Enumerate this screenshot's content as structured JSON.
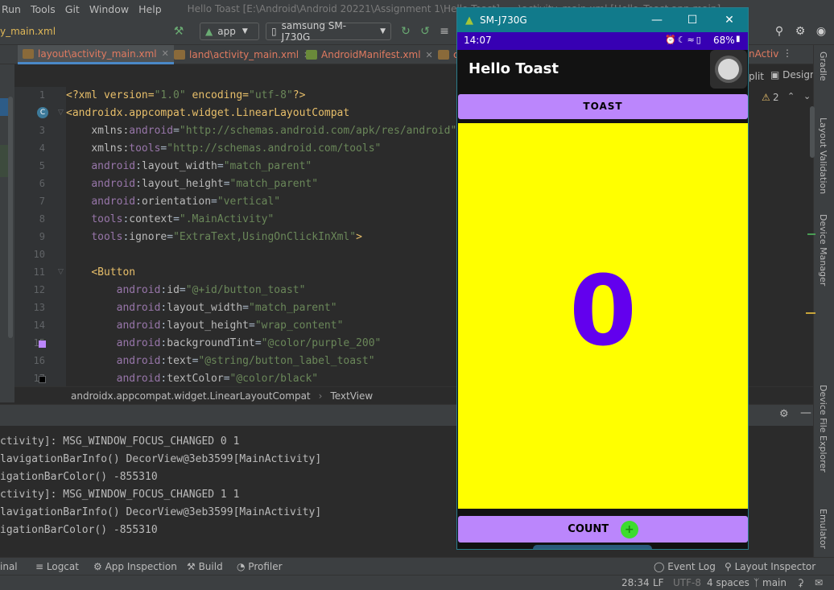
{
  "menubar": {
    "items": [
      "Run",
      "Tools",
      "Git",
      "Window",
      "Help"
    ],
    "title": "Hello Toast [E:\\Android\\Android 20221\\Assignment 1\\Hello Toast] - ...\\activity_main.xml [Hello_Toast.app.main]"
  },
  "toolbar": {
    "file": "y_main.xml",
    "run_config": "app",
    "device": "samsung SM-J730G"
  },
  "tabs": [
    {
      "label": "layout\\activity_main.xml"
    },
    {
      "label": "land\\activity_main.xml"
    },
    {
      "label": "AndroidManifest.xml"
    },
    {
      "label": "c"
    }
  ],
  "editor_extras": {
    "split": "plit",
    "design": "Design",
    "warnings": "2",
    "hidden_tab": "nActiv"
  },
  "code": {
    "lines": [
      "1",
      "2",
      "3",
      "4",
      "5",
      "6",
      "7",
      "8",
      "9",
      "10",
      "11",
      "12",
      "13",
      "14",
      "15",
      "16",
      "17"
    ]
  },
  "breadcrumb": {
    "parent": "androidx.appcompat.widget.LinearLayoutCompat",
    "child": "TextView"
  },
  "logs": [
    "ctivity]: MSG_WINDOW_FOCUS_CHANGED 0 1",
    "lavigationBarInfo() DecorView@3eb3599[MainActivity]",
    "igationBarColor() -855310",
    "ctivity]: MSG_WINDOW_FOCUS_CHANGED 1 1",
    "lavigationBarInfo() DecorView@3eb3599[MainActivity]",
    "igationBarColor() -855310"
  ],
  "tooltabs": {
    "terminal": "inal",
    "logcat": "Logcat",
    "app_inspection": "App Inspection",
    "build": "Build",
    "profiler": "Profiler",
    "event_log": "Event Log",
    "layout_inspector": "Layout Inspector"
  },
  "status": {
    "position": "28:34",
    "line_sep": "LF",
    "encoding": "UTF-8",
    "indent": "4 spaces",
    "branch": "main"
  },
  "right_strip": [
    "Gradle",
    "Layout Validation",
    "Device Manager",
    "Device File Explorer",
    "Emulator"
  ],
  "emulator": {
    "window_title": "SM-J730G",
    "phone_time": "14:07",
    "battery": "68%",
    "app_title": "Hello Toast",
    "toast_label": "TOAST",
    "count": "0",
    "count_label": "COUNT"
  },
  "colors": {
    "accent_purple": "#bb86fc",
    "status_bar": "#3700b3",
    "count_text": "#6200ee",
    "count_bg": "#ffff00",
    "emulator_title": "#117a8b"
  }
}
